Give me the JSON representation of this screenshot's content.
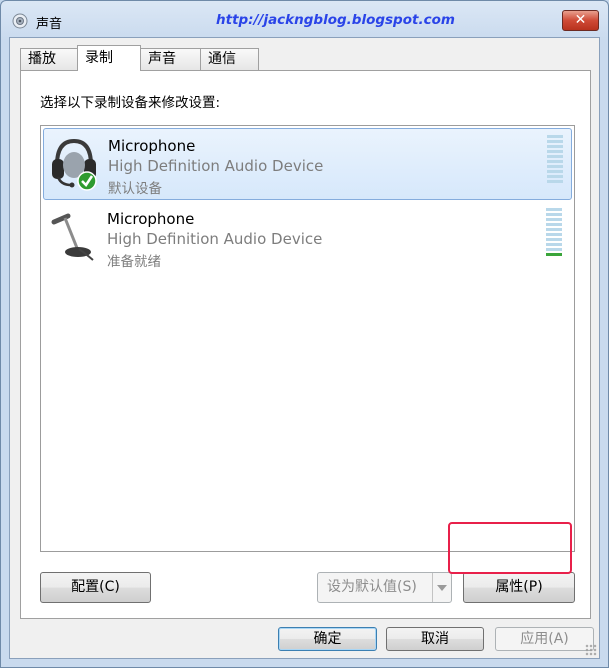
{
  "window": {
    "title": "声音",
    "watermark_url": "http://jackngblog.blogspot.com",
    "close_glyph": "✕"
  },
  "tabs": [
    {
      "label": "播放",
      "active": false
    },
    {
      "label": "录制",
      "active": true
    },
    {
      "label": "声音",
      "active": false
    },
    {
      "label": "通信",
      "active": false
    }
  ],
  "recording": {
    "instruction": "选择以下录制设备来修改设置:",
    "devices": [
      {
        "name": "Microphone",
        "description": "High Definition Audio Device",
        "status": "默认设备",
        "icon": "headset-microphone-icon",
        "is_default": true,
        "selected": true,
        "level_bars_on": 0
      },
      {
        "name": "Microphone",
        "description": "High Definition Audio Device",
        "status": "准备就绪",
        "icon": "desk-microphone-icon",
        "is_default": false,
        "selected": false,
        "level_bars_on": 1
      }
    ],
    "buttons": {
      "configure": "配置(C)",
      "set_default": "设为默认值(S)",
      "properties": "属性(P)"
    }
  },
  "dialog_buttons": {
    "ok": "确定",
    "cancel": "取消",
    "apply": "应用(A)"
  },
  "colors": {
    "accent_url": "#2a44e8",
    "highlight_box": "#e8204a",
    "selection": "#d6e8fb"
  }
}
